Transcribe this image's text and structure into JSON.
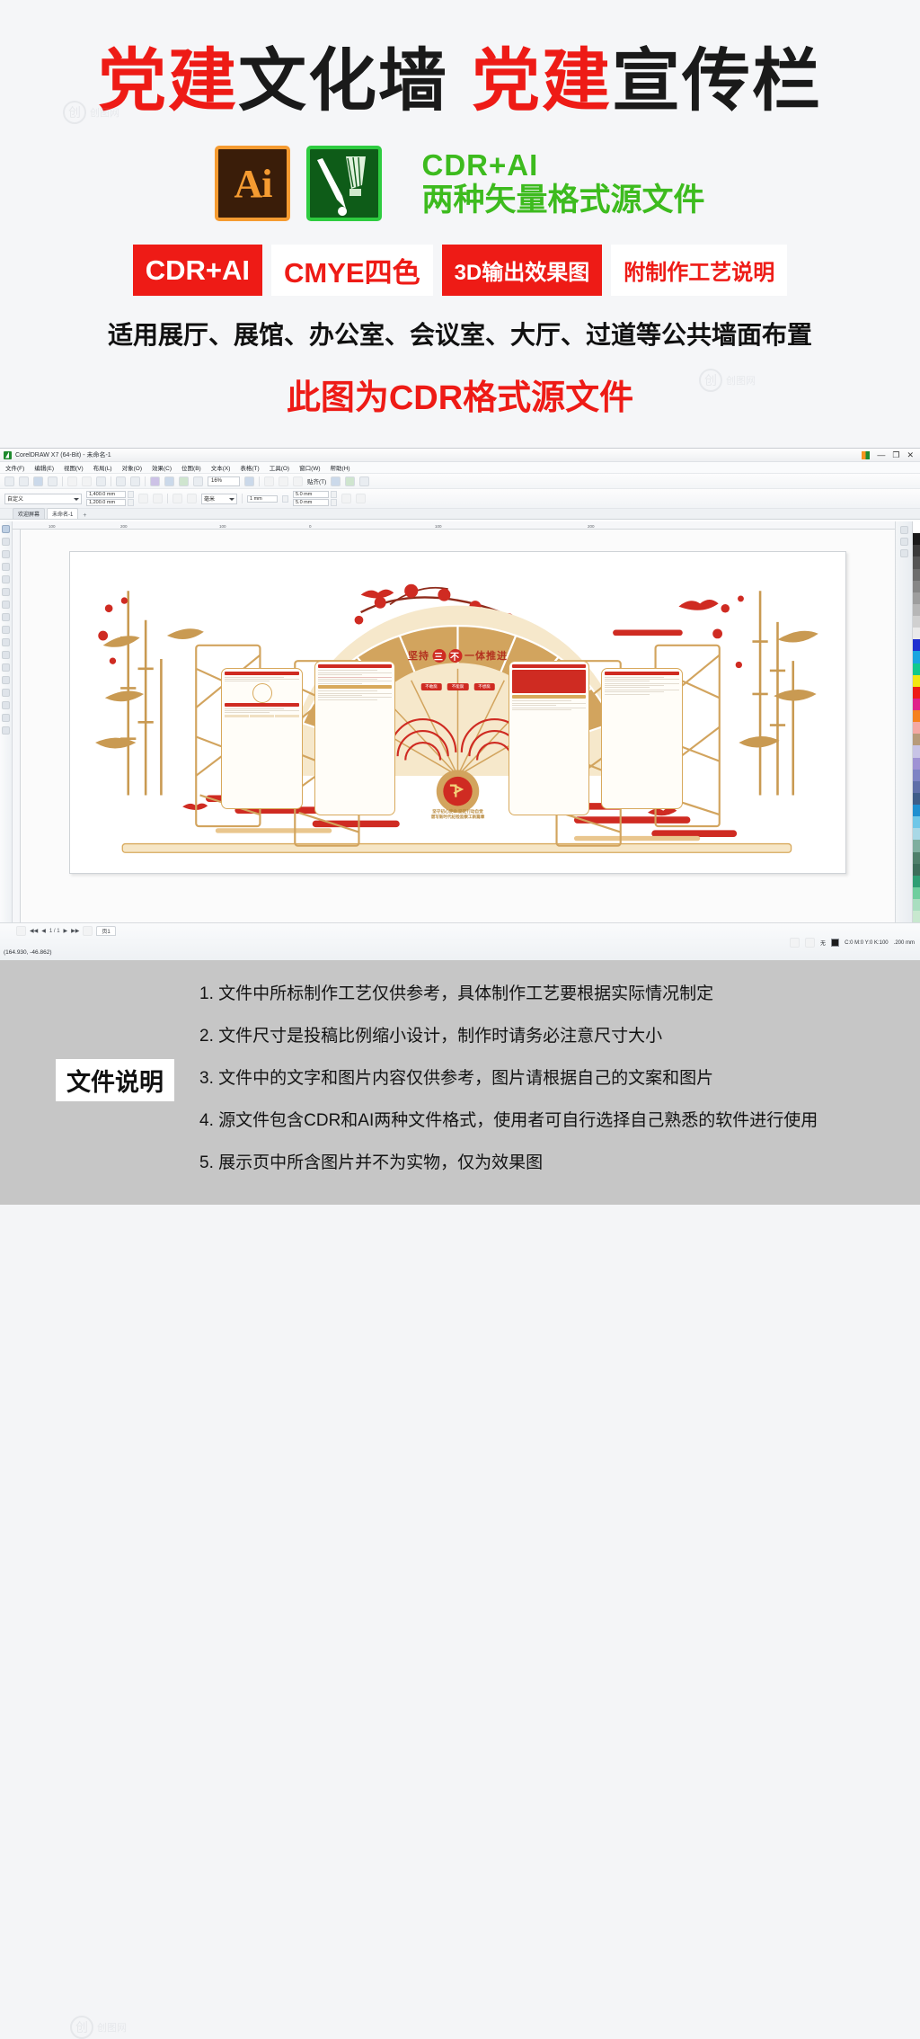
{
  "promo": {
    "title_parts": [
      {
        "text": "党建",
        "color": "red"
      },
      {
        "text": "文化墙",
        "color": "black"
      },
      {
        "text": "党建",
        "color": "red"
      },
      {
        "text": "宣传栏",
        "color": "black"
      }
    ],
    "title_full": "党建文化墙 党建宣传栏",
    "ai_logo_label": "Ai",
    "cdr_logo_label": "CorelDRAW",
    "format_line1": "CDR+AI",
    "format_line2": "两种矢量格式源文件",
    "badges": [
      {
        "label": "CDR+AI",
        "style": "solid"
      },
      {
        "label": "CMYE四色",
        "style": "ghost"
      },
      {
        "label": "3D输出效果图",
        "style": "solid"
      },
      {
        "label": "附制作工艺说明",
        "style": "ghost"
      }
    ],
    "applies_text": "适用展厅、展馆、办公室、会议室、大厅、过道等公共墙面布置",
    "cdr_note": "此图为CDR格式源文件",
    "colors": {
      "red": "#ee1b16",
      "green": "#3dbb1e",
      "black": "#1a1a1a"
    },
    "watermark": "创图网"
  },
  "coreldraw": {
    "title": "CorelDRAW X7 (64-Bit) - 未命名-1",
    "window_controls": [
      "—",
      "❐",
      "✕"
    ],
    "menus": [
      "文件(F)",
      "编辑(E)",
      "视图(V)",
      "布局(L)",
      "对象(O)",
      "效果(C)",
      "位图(B)",
      "文本(X)",
      "表格(T)",
      "工具(O)",
      "窗口(W)",
      "帮助(H)"
    ],
    "toolbar": {
      "zoom_level": "16%",
      "snap_label": "贴齐(T)"
    },
    "property_bar": {
      "preset": "自定义",
      "width": "1,400.0 mm",
      "height": "1,200.0 mm",
      "units": "毫米",
      "nudge": "1 mm",
      "outline_w": "5.0 mm",
      "outline_h": "5.0 mm"
    },
    "tabs": [
      {
        "label": "欢迎屏幕",
        "active": false
      },
      {
        "label": "未命名-1",
        "active": true
      }
    ],
    "tab_add": "+",
    "ruler_ticks": [
      "100",
      "200",
      "100",
      "0",
      "100",
      "200"
    ],
    "status": {
      "page_nav": "1 / 1",
      "page_tab": "页1",
      "coords": "(164.930, -46.862)",
      "fill_none": "无",
      "color_values": "C:0 M:0 Y:0 K:100",
      "outline_width": ".200 mm"
    },
    "artwork": {
      "fan_title_pre": "坚持",
      "fan_circle_1": "三",
      "fan_circle_2": "不",
      "fan_title_post": "一体推进",
      "fan_badges": [
        "不敢腐",
        "不能腐",
        "不想腐"
      ],
      "slogan_line1": "坚守初心使命 坚定行动自觉",
      "slogan_line2": "谱写新时代纪检监察工新篇章",
      "colors": {
        "gold": "#d2a45e",
        "red": "#cf2b22",
        "cream": "#f3e2c0"
      }
    }
  },
  "footer": {
    "label": "文件说明",
    "notes": [
      "1. 文件中所标制作工艺仅供参考，具体制作工艺要根据实际情况制定",
      "2. 文件尺寸是投稿比例缩小设计，制作时请务必注意尺寸大小",
      "3. 文件中的文字和图片内容仅供参考，图片请根据自己的文案和图片",
      "4. 源文件包含CDR和AI两种文件格式，使用者可自行选择自己熟悉的软件进行使用",
      "5. 展示页中所含图片并不为实物，仅为效果图"
    ]
  }
}
